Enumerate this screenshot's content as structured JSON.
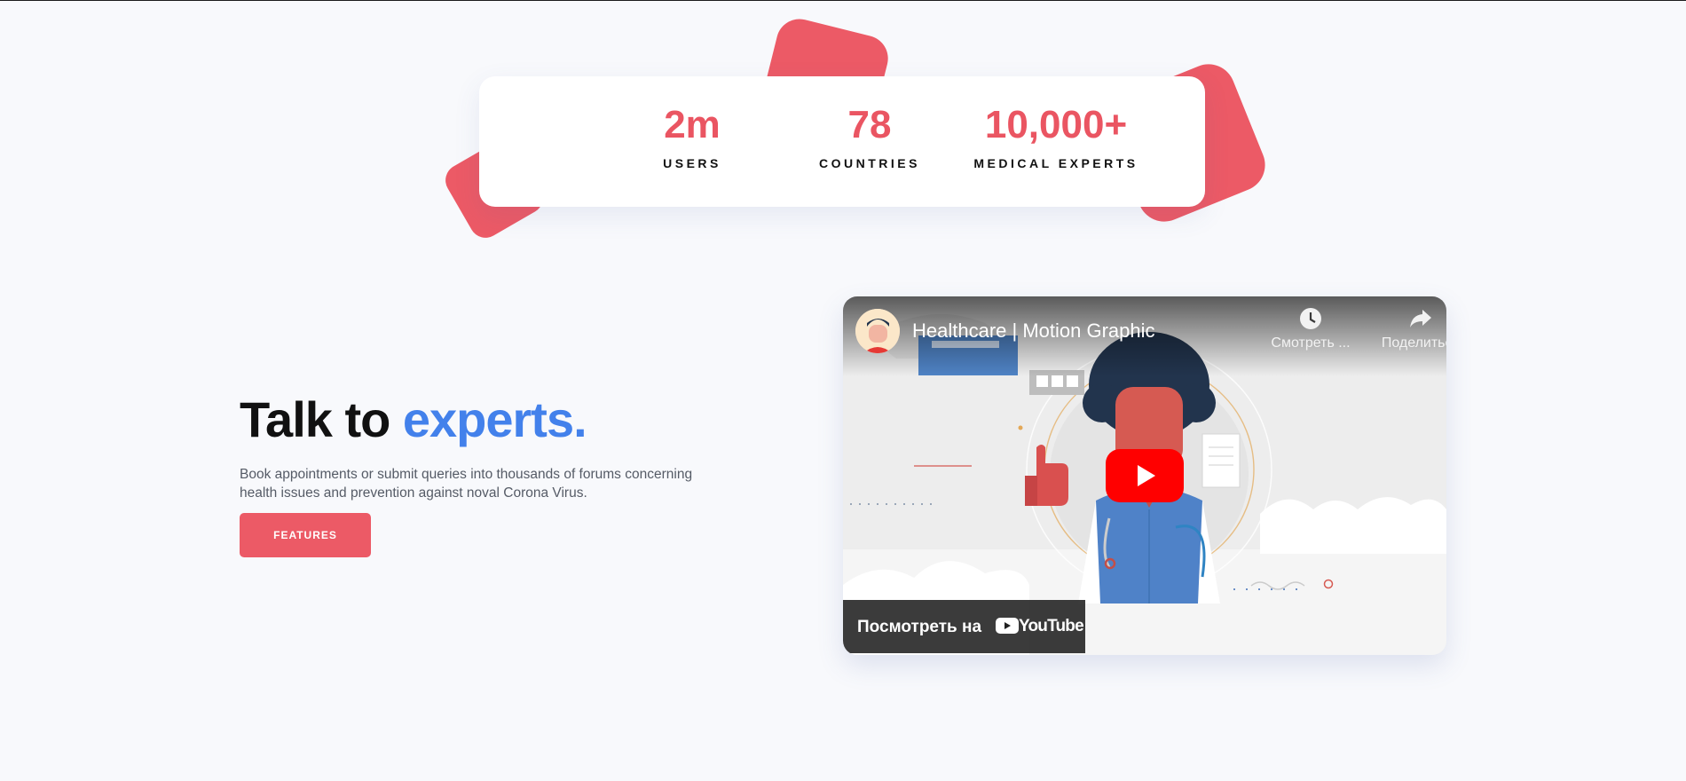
{
  "stats": [
    {
      "value": "2m",
      "label": "USERS"
    },
    {
      "value": "78",
      "label": "COUNTRIES"
    },
    {
      "value": "10,000+",
      "label": "MEDICAL EXPERTS"
    }
  ],
  "hero": {
    "heading_main": "Talk to",
    "heading_accent": "experts.",
    "description": "Book appointments or submit queries into thousands of forums concerning health issues and prevention against noval Corona Virus.",
    "button_label": "FEATURES"
  },
  "video": {
    "title": "Healthcare | Motion Graphic",
    "watch_later_label": "Смотреть ...",
    "share_label": "Поделиться",
    "watch_on_label": "Посмотреть на",
    "platform_label": "YouTube"
  },
  "colors": {
    "accent_red": "#ec5a66",
    "accent_blue": "#4381eb",
    "youtube_red": "#ff0000"
  },
  "icons": [
    "clock-icon",
    "share-arrow-icon",
    "play-icon",
    "youtube-logo-icon"
  ]
}
